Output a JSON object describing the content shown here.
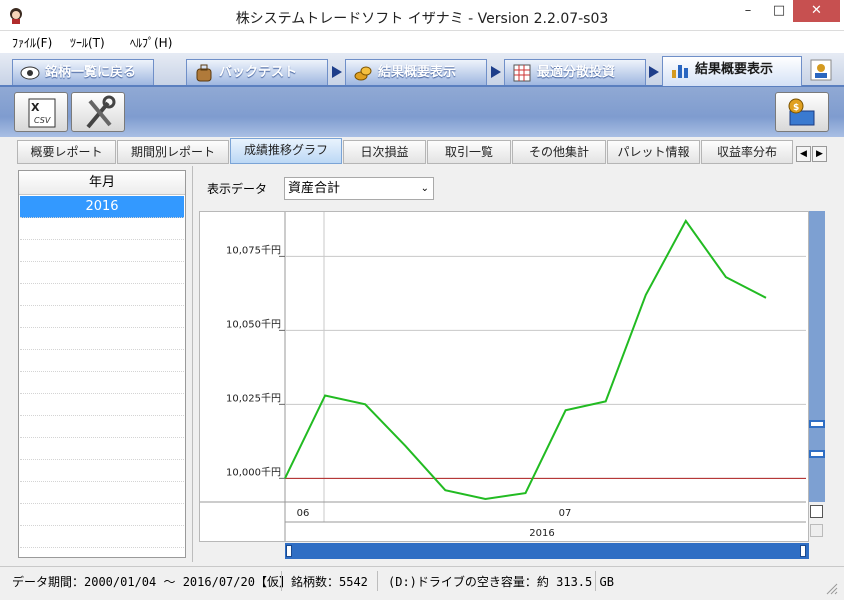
{
  "window": {
    "title": "株システムトレードソフト イザナミ - Version 2.2.07-s03",
    "minimize": "–",
    "maximize": "□",
    "close": "✕"
  },
  "menu": [
    "ﾌｧｲﾙ(F)",
    "ﾂｰﾙ(T)",
    "ﾍﾙﾌﾟ(H)"
  ],
  "nav_tabs": [
    {
      "label": "銘柄一覧に戻る",
      "icon": "eye-icon"
    },
    {
      "label": "バックテスト",
      "icon": "bag-icon"
    },
    {
      "label": "結果概要表示",
      "icon": "coins-icon"
    },
    {
      "label": "最適分散投資",
      "icon": "grid-calculator-icon"
    },
    {
      "label": "結果概要表示",
      "icon": "bar-chart-icon",
      "active": true
    }
  ],
  "toolbar": {
    "csv_button": "CSV",
    "tools_button": "tools",
    "money_button": "money"
  },
  "report_tabs": [
    "概要レポート",
    "期間別レポート",
    "成績推移グラフ",
    "日次損益",
    "取引一覧",
    "その他集計",
    "パレット情報",
    "収益率分布"
  ],
  "active_report_tab": "成績推移グラフ",
  "left_list": {
    "header": "年月",
    "items": [
      "2016"
    ],
    "selected": "2016"
  },
  "display": {
    "label": "表示データ",
    "selected": "資産合計"
  },
  "chart_data": {
    "type": "line",
    "y_ticks": [
      "10,000千円",
      "10,025千円",
      "10,050千円",
      "10,075千円"
    ],
    "y_tick_values": [
      10000,
      10025,
      10050,
      10075
    ],
    "ylim": [
      9992,
      10090
    ],
    "baseline": 10000,
    "x_month_labels": [
      "06",
      "07"
    ],
    "x_year_label": "2016",
    "series": [
      {
        "color": "#22bb22",
        "values": [
          10000,
          10028,
          10025,
          10011,
          9996,
          9993,
          9995,
          10023,
          10026,
          10062,
          10087,
          10068,
          10061
        ]
      }
    ],
    "baseline_color": "#b22222"
  },
  "status": {
    "period": "データ期間：2000/01/04 ～ 2016/07/20【仮】",
    "count": "銘柄数：5542",
    "disk": "(D:)ドライブの空き容量：約 313.5 GB"
  }
}
